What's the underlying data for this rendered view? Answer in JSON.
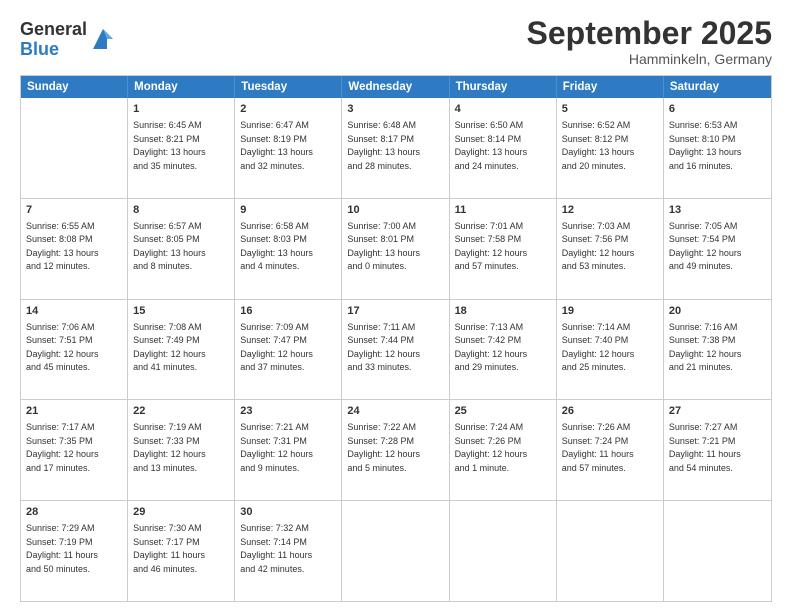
{
  "logo": {
    "general": "General",
    "blue": "Blue"
  },
  "title": "September 2025",
  "location": "Hamminkeln, Germany",
  "header_days": [
    "Sunday",
    "Monday",
    "Tuesday",
    "Wednesday",
    "Thursday",
    "Friday",
    "Saturday"
  ],
  "weeks": [
    [
      {
        "day": "",
        "lines": []
      },
      {
        "day": "1",
        "lines": [
          "Sunrise: 6:45 AM",
          "Sunset: 8:21 PM",
          "Daylight: 13 hours",
          "and 35 minutes."
        ]
      },
      {
        "day": "2",
        "lines": [
          "Sunrise: 6:47 AM",
          "Sunset: 8:19 PM",
          "Daylight: 13 hours",
          "and 32 minutes."
        ]
      },
      {
        "day": "3",
        "lines": [
          "Sunrise: 6:48 AM",
          "Sunset: 8:17 PM",
          "Daylight: 13 hours",
          "and 28 minutes."
        ]
      },
      {
        "day": "4",
        "lines": [
          "Sunrise: 6:50 AM",
          "Sunset: 8:14 PM",
          "Daylight: 13 hours",
          "and 24 minutes."
        ]
      },
      {
        "day": "5",
        "lines": [
          "Sunrise: 6:52 AM",
          "Sunset: 8:12 PM",
          "Daylight: 13 hours",
          "and 20 minutes."
        ]
      },
      {
        "day": "6",
        "lines": [
          "Sunrise: 6:53 AM",
          "Sunset: 8:10 PM",
          "Daylight: 13 hours",
          "and 16 minutes."
        ]
      }
    ],
    [
      {
        "day": "7",
        "lines": [
          "Sunrise: 6:55 AM",
          "Sunset: 8:08 PM",
          "Daylight: 13 hours",
          "and 12 minutes."
        ]
      },
      {
        "day": "8",
        "lines": [
          "Sunrise: 6:57 AM",
          "Sunset: 8:05 PM",
          "Daylight: 13 hours",
          "and 8 minutes."
        ]
      },
      {
        "day": "9",
        "lines": [
          "Sunrise: 6:58 AM",
          "Sunset: 8:03 PM",
          "Daylight: 13 hours",
          "and 4 minutes."
        ]
      },
      {
        "day": "10",
        "lines": [
          "Sunrise: 7:00 AM",
          "Sunset: 8:01 PM",
          "Daylight: 13 hours",
          "and 0 minutes."
        ]
      },
      {
        "day": "11",
        "lines": [
          "Sunrise: 7:01 AM",
          "Sunset: 7:58 PM",
          "Daylight: 12 hours",
          "and 57 minutes."
        ]
      },
      {
        "day": "12",
        "lines": [
          "Sunrise: 7:03 AM",
          "Sunset: 7:56 PM",
          "Daylight: 12 hours",
          "and 53 minutes."
        ]
      },
      {
        "day": "13",
        "lines": [
          "Sunrise: 7:05 AM",
          "Sunset: 7:54 PM",
          "Daylight: 12 hours",
          "and 49 minutes."
        ]
      }
    ],
    [
      {
        "day": "14",
        "lines": [
          "Sunrise: 7:06 AM",
          "Sunset: 7:51 PM",
          "Daylight: 12 hours",
          "and 45 minutes."
        ]
      },
      {
        "day": "15",
        "lines": [
          "Sunrise: 7:08 AM",
          "Sunset: 7:49 PM",
          "Daylight: 12 hours",
          "and 41 minutes."
        ]
      },
      {
        "day": "16",
        "lines": [
          "Sunrise: 7:09 AM",
          "Sunset: 7:47 PM",
          "Daylight: 12 hours",
          "and 37 minutes."
        ]
      },
      {
        "day": "17",
        "lines": [
          "Sunrise: 7:11 AM",
          "Sunset: 7:44 PM",
          "Daylight: 12 hours",
          "and 33 minutes."
        ]
      },
      {
        "day": "18",
        "lines": [
          "Sunrise: 7:13 AM",
          "Sunset: 7:42 PM",
          "Daylight: 12 hours",
          "and 29 minutes."
        ]
      },
      {
        "day": "19",
        "lines": [
          "Sunrise: 7:14 AM",
          "Sunset: 7:40 PM",
          "Daylight: 12 hours",
          "and 25 minutes."
        ]
      },
      {
        "day": "20",
        "lines": [
          "Sunrise: 7:16 AM",
          "Sunset: 7:38 PM",
          "Daylight: 12 hours",
          "and 21 minutes."
        ]
      }
    ],
    [
      {
        "day": "21",
        "lines": [
          "Sunrise: 7:17 AM",
          "Sunset: 7:35 PM",
          "Daylight: 12 hours",
          "and 17 minutes."
        ]
      },
      {
        "day": "22",
        "lines": [
          "Sunrise: 7:19 AM",
          "Sunset: 7:33 PM",
          "Daylight: 12 hours",
          "and 13 minutes."
        ]
      },
      {
        "day": "23",
        "lines": [
          "Sunrise: 7:21 AM",
          "Sunset: 7:31 PM",
          "Daylight: 12 hours",
          "and 9 minutes."
        ]
      },
      {
        "day": "24",
        "lines": [
          "Sunrise: 7:22 AM",
          "Sunset: 7:28 PM",
          "Daylight: 12 hours",
          "and 5 minutes."
        ]
      },
      {
        "day": "25",
        "lines": [
          "Sunrise: 7:24 AM",
          "Sunset: 7:26 PM",
          "Daylight: 12 hours",
          "and 1 minute."
        ]
      },
      {
        "day": "26",
        "lines": [
          "Sunrise: 7:26 AM",
          "Sunset: 7:24 PM",
          "Daylight: 11 hours",
          "and 57 minutes."
        ]
      },
      {
        "day": "27",
        "lines": [
          "Sunrise: 7:27 AM",
          "Sunset: 7:21 PM",
          "Daylight: 11 hours",
          "and 54 minutes."
        ]
      }
    ],
    [
      {
        "day": "28",
        "lines": [
          "Sunrise: 7:29 AM",
          "Sunset: 7:19 PM",
          "Daylight: 11 hours",
          "and 50 minutes."
        ]
      },
      {
        "day": "29",
        "lines": [
          "Sunrise: 7:30 AM",
          "Sunset: 7:17 PM",
          "Daylight: 11 hours",
          "and 46 minutes."
        ]
      },
      {
        "day": "30",
        "lines": [
          "Sunrise: 7:32 AM",
          "Sunset: 7:14 PM",
          "Daylight: 11 hours",
          "and 42 minutes."
        ]
      },
      {
        "day": "",
        "lines": []
      },
      {
        "day": "",
        "lines": []
      },
      {
        "day": "",
        "lines": []
      },
      {
        "day": "",
        "lines": []
      }
    ]
  ]
}
